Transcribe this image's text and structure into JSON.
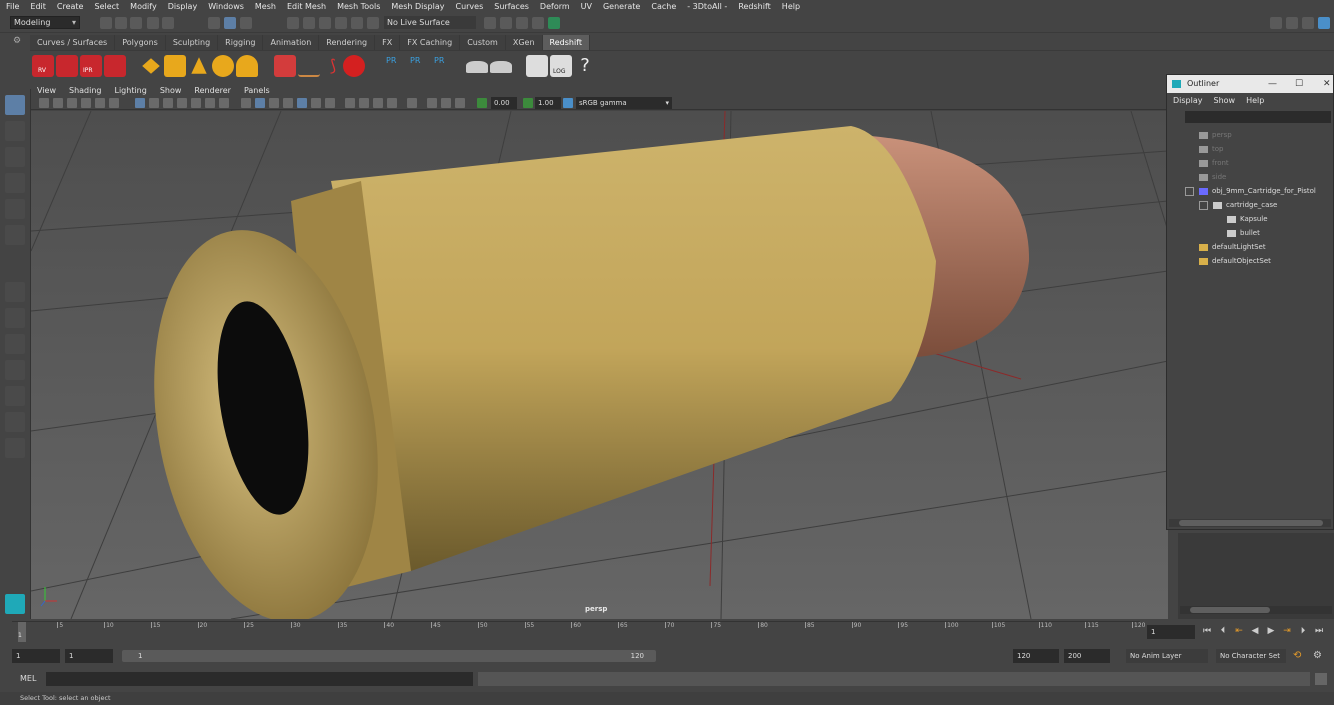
{
  "menubar": [
    "File",
    "Edit",
    "Create",
    "Select",
    "Modify",
    "Display",
    "Windows",
    "Mesh",
    "Edit Mesh",
    "Mesh Tools",
    "Mesh Display",
    "Curves",
    "Surfaces",
    "Deform",
    "UV",
    "Generate",
    "Cache",
    "- 3DtoAll -",
    "Redshift",
    "Help"
  ],
  "status": {
    "mode": "Modeling",
    "live_surface": "No Live Surface"
  },
  "shelf_tabs": [
    "Curves / Surfaces",
    "Polygons",
    "Sculpting",
    "Rigging",
    "Animation",
    "Rendering",
    "FX",
    "FX Caching",
    "Custom",
    "XGen",
    "Redshift"
  ],
  "shelf_active_tab": "Redshift",
  "shelf_labels": {
    "rv": "RV",
    "ipr": "IPR",
    "pr": "PR",
    "log": "LOG"
  },
  "viewport_menu": [
    "View",
    "Shading",
    "Lighting",
    "Show",
    "Renderer",
    "Panels"
  ],
  "viewport_toolbar": {
    "exposure": "0.00",
    "gamma": "1.00",
    "colorspace": "sRGB gamma"
  },
  "viewport_camera": "persp",
  "outliner": {
    "title": "Outliner",
    "menu": [
      "Display",
      "Show",
      "Help"
    ],
    "items": [
      {
        "label": "persp",
        "dim": true
      },
      {
        "label": "top",
        "dim": true
      },
      {
        "label": "front",
        "dim": true
      },
      {
        "label": "side",
        "dim": true
      },
      {
        "label": "obj_9mm_Cartridge_for_Pistol",
        "dim": false
      },
      {
        "label": "cartridge_case",
        "dim": false
      },
      {
        "label": "Kapsule",
        "dim": false
      },
      {
        "label": "bullet",
        "dim": false
      },
      {
        "label": "defaultLightSet",
        "dim": false
      },
      {
        "label": "defaultObjectSet",
        "dim": false
      }
    ]
  },
  "timeline": {
    "ticks": [
      "5",
      "10",
      "15",
      "20",
      "25",
      "30",
      "35",
      "40",
      "45",
      "50",
      "55",
      "60",
      "65",
      "70",
      "75",
      "80",
      "85",
      "90",
      "95",
      "100",
      "105",
      "110",
      "115",
      "120"
    ],
    "current_frame_label": "1",
    "current_frame": "1"
  },
  "range": {
    "start": "1",
    "playback_start": "1",
    "slider_start": "1",
    "slider_end": "120",
    "playback_end": "120",
    "end": "200",
    "anim_layer": "No Anim Layer",
    "character_set": "No Character Set"
  },
  "command_line": {
    "label": "MEL"
  },
  "help_line": "Select Tool: select an object"
}
